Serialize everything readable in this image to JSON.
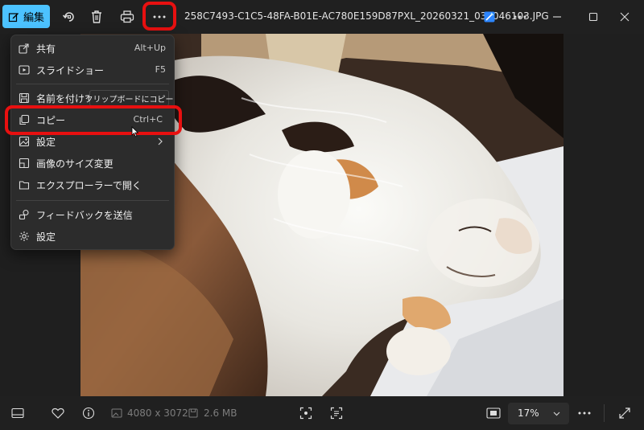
{
  "titlebar": {
    "edit_label": "編集",
    "filename": "258C7493-C1C5-48FA-B01E-AC780E159D87PXL_20260321_032046103.JPG"
  },
  "menu": {
    "items": [
      {
        "label": "共有",
        "shortcut": "Alt+Up",
        "icon": "share-icon"
      },
      {
        "label": "スライドショー",
        "shortcut": "F5",
        "icon": "slideshow-icon"
      },
      {
        "label": "名前を付けて保存",
        "shortcut": "",
        "icon": "save-icon"
      },
      {
        "label": "コピー",
        "shortcut": "Ctrl+C",
        "icon": "copy-icon"
      },
      {
        "label": "設定",
        "shortcut": "",
        "icon": "set-as-icon"
      },
      {
        "label": "画像のサイズ変更",
        "shortcut": "",
        "icon": "resize-icon"
      },
      {
        "label": "エクスプローラーで開く",
        "shortcut": "",
        "icon": "folder-icon"
      },
      {
        "label": "フィードバックを送信",
        "shortcut": "",
        "icon": "feedback-icon"
      },
      {
        "label": "設定",
        "shortcut": "",
        "icon": "gear-icon"
      }
    ],
    "tooltip": "クリップボードにコピー"
  },
  "bottombar": {
    "dimensions": "4080 x 3072",
    "filesize": "2.6 MB",
    "zoom": "17%"
  },
  "colors": {
    "accent": "#4cc2ff",
    "highlight": "#e81010",
    "background": "#202020"
  }
}
